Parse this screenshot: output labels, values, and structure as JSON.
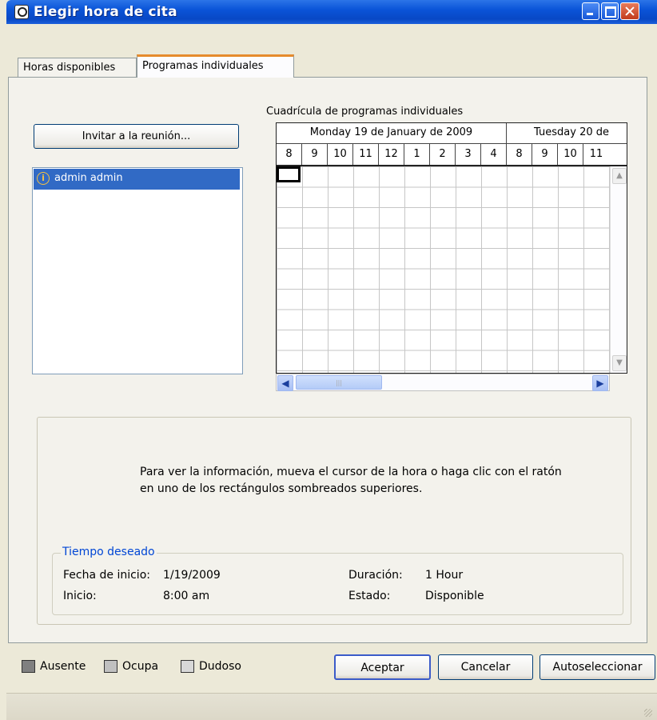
{
  "window": {
    "title": "Elegir hora de cita"
  },
  "tabs": [
    {
      "label": "Horas disponibles"
    },
    {
      "label": "Programas individuales"
    }
  ],
  "invite_button": {
    "label": "Invitar a la reunión..."
  },
  "attendees": [
    {
      "name": "admin admin",
      "icon": "info-icon"
    }
  ],
  "schedule_grid": {
    "caption": "Cuadrícula de programas individuales",
    "days": [
      "Monday 19 de January de 2009",
      "Tuesday 20 de"
    ],
    "hours": [
      "8",
      "9",
      "10",
      "11",
      "12",
      "1",
      "2",
      "3",
      "4",
      "8",
      "9",
      "10",
      "11"
    ]
  },
  "info": {
    "message_line1": "Para ver la información, mueva el cursor de la hora o haga clic con el ratón",
    "message_line2": "en uno de los rectángulos sombreados superiores."
  },
  "desired_time": {
    "legend": "Tiempo deseado",
    "start_date_label": "Fecha de inicio:",
    "start_date_value": "1/19/2009",
    "start_label": "Inicio:",
    "start_value": "8:00 am",
    "duration_label": "Duración:",
    "duration_value": "1 Hour",
    "status_label": "Estado:",
    "status_value": "Disponible"
  },
  "legend": [
    {
      "label": "Ausente",
      "color": "#808080"
    },
    {
      "label": "Ocupa",
      "color": "#c0c0c0"
    },
    {
      "label": "Dudoso",
      "color": "#d8d8d8"
    }
  ],
  "buttons": {
    "ok": "Aceptar",
    "cancel": "Cancelar",
    "auto": "Autoseleccionar"
  }
}
